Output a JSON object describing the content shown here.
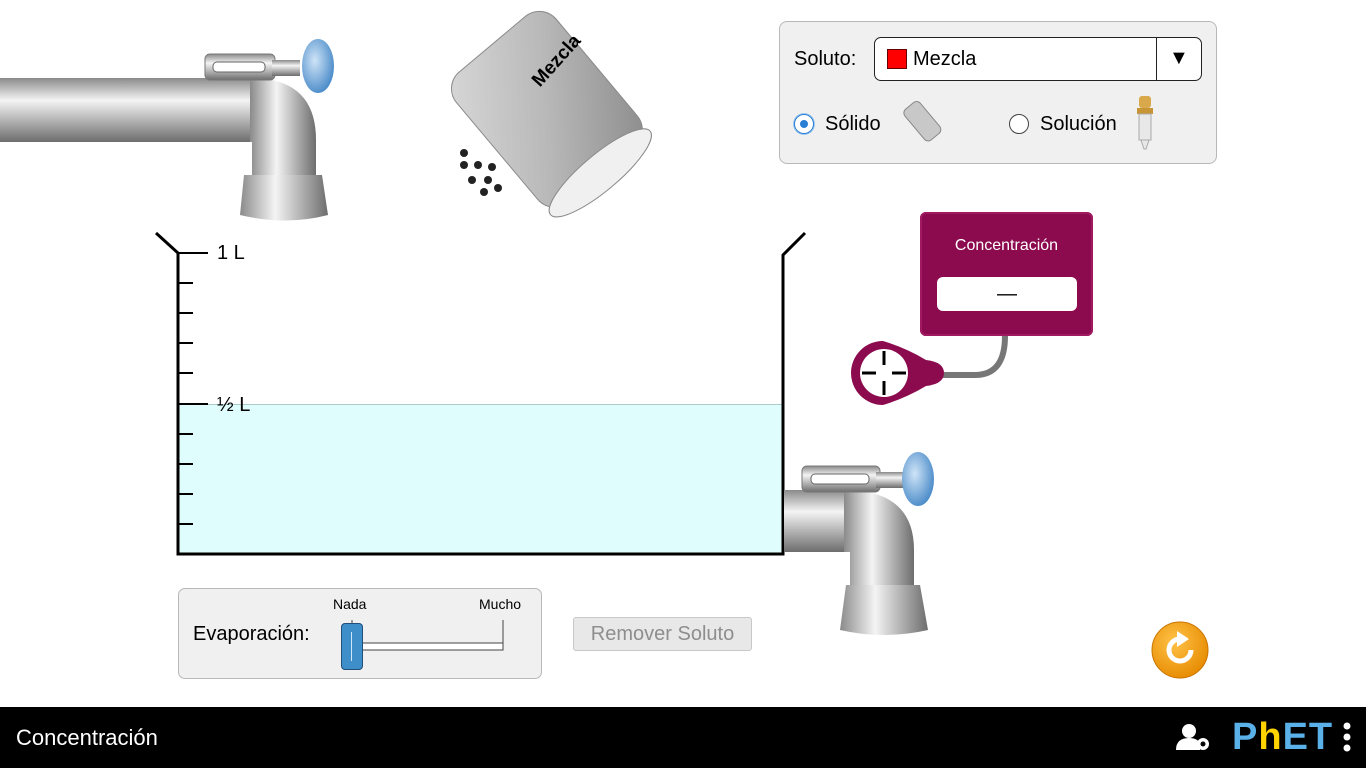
{
  "solute_panel": {
    "label": "Soluto:",
    "selected_solute": "Mezcla",
    "selected_color": "#ff0000",
    "options": [
      {
        "label": "Sólido",
        "selected": true,
        "icon": "shaker-icon"
      },
      {
        "label": "Solución",
        "selected": false,
        "icon": "dropper-icon"
      }
    ]
  },
  "shaker": {
    "label": "Mezcla"
  },
  "beaker": {
    "labels": [
      "1 L",
      "½ L"
    ],
    "volume_liters": 0.5,
    "solution_color": "#e0fdfd"
  },
  "meter": {
    "title": "Concentración",
    "value": "—",
    "color": "#8c0b4e"
  },
  "evaporation": {
    "label": "Evaporación:",
    "min_label": "Nada",
    "max_label": "Mucho",
    "value": 0
  },
  "remove_solute_button": {
    "label": "Remover Soluto",
    "enabled": false
  },
  "nav": {
    "title": "Concentración",
    "logo": "PhET"
  },
  "icons": [
    "faucet-icon",
    "reset-icon",
    "user-settings-icon",
    "more-menu-icon"
  ]
}
